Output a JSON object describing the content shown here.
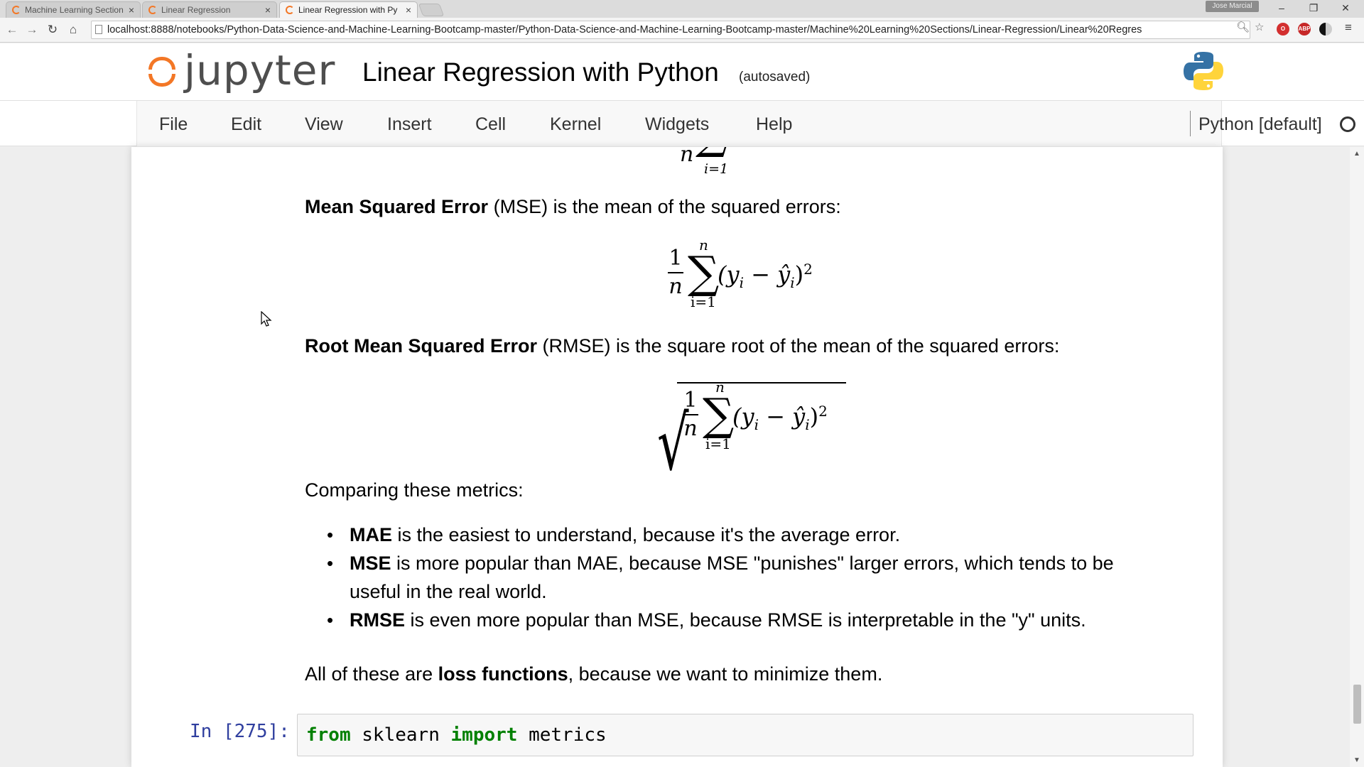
{
  "browser": {
    "tabs": [
      {
        "title": "Machine Learning Section",
        "active": false
      },
      {
        "title": "Linear Regression",
        "active": false
      },
      {
        "title": "Linear Regression with Py",
        "active": true
      }
    ],
    "user_badge": "Jose Marcial",
    "window_controls": {
      "minimize": "–",
      "restore": "❐",
      "close": "✕"
    },
    "url": "localhost:8888/notebooks/Python-Data-Science-and-Machine-Learning-Bootcamp-master/Python-Data-Science-and-Machine-Learning-Bootcamp-master/Machine%20Learning%20Sections/Linear-Regression/Linear%20Regres",
    "nav_icons": {
      "back": "←",
      "forward": "→",
      "reload": "↻",
      "home": "⌂"
    },
    "omnibox_icons": [
      "zoom-icon",
      "star-icon"
    ],
    "extensions": [
      "opera-icon",
      "adblock-icon",
      "contrast-icon",
      "menu-icon"
    ]
  },
  "jupyter": {
    "logo_text": "jupyter",
    "notebook_name": "Linear Regression with Python",
    "save_status": "(autosaved)",
    "menu": [
      "File",
      "Edit",
      "View",
      "Insert",
      "Cell",
      "Kernel",
      "Widgets",
      "Help"
    ],
    "kernel_name": "Python [default]",
    "kernel_status": "idle"
  },
  "content": {
    "partial_formula": {
      "n": "n",
      "sub": "i=1"
    },
    "mse": {
      "bold": "Mean Squared Error",
      "rest": " (MSE) is the mean of the squared errors:"
    },
    "mse_formula": {
      "num": "1",
      "den": "n",
      "upper": "n",
      "lower": "i=1",
      "body_a": "(y",
      "body_i": "i",
      "body_b": " − ŷ",
      "body_i2": "i",
      "body_c": ")",
      "power": "2"
    },
    "rmse": {
      "bold": "Root Mean Squared Error",
      "rest": " (RMSE) is the square root of the mean of the squared errors:"
    },
    "rmse_formula": {
      "num": "1",
      "den": "n",
      "upper": "n",
      "lower": "i=1",
      "body_a": "(y",
      "body_i": "i",
      "body_b": " − ŷ",
      "body_i2": "i",
      "body_c": ")",
      "power": "2"
    },
    "comparing": "Comparing these metrics:",
    "bullets": [
      {
        "bold": "MAE",
        "rest": " is the easiest to understand, because it's the average error."
      },
      {
        "bold": "MSE",
        "rest": " is more popular than MAE, because MSE \"punishes\" larger errors, which tends to be useful in the real world."
      },
      {
        "bold": "RMSE",
        "rest": " is even more popular than MSE, because RMSE is interpretable in the \"y\" units."
      }
    ],
    "loss": {
      "pre": "All of these are ",
      "bold": "loss functions",
      "post": ", because we want to minimize them."
    }
  },
  "code_cell": {
    "prompt": "In [275]:",
    "kw1": "from",
    "mod": " sklearn ",
    "kw2": "import",
    "name": " metrics"
  },
  "colors": {
    "jupyter_orange": "#f37726",
    "prompt_blue": "#303f9f",
    "keyword_green": "#008000"
  }
}
